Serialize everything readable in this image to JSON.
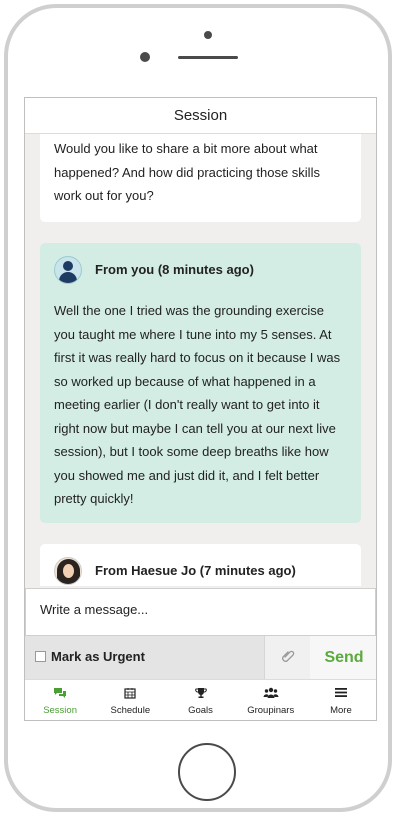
{
  "header": {
    "title": "Session"
  },
  "messages": {
    "previous": {
      "text": "Would you like to share a bit more about what happened? And how did practicing those skills work out for you?"
    },
    "mine": {
      "from": "From you (8 minutes ago)",
      "text": "Well the one I tried was the grounding exercise you taught me where I tune into my 5 senses. At first it was really hard to focus on it because I was so worked up because of what happened in a meeting earlier (I don't really want to get into it right now but maybe I can tell you at our next live session), but I took some deep breaths like how you showed me and just did it, and I felt better pretty quickly!"
    },
    "other": {
      "from": "From Haesue Jo (7 minutes ago)"
    }
  },
  "composer": {
    "placeholder": "Write a message..."
  },
  "actions": {
    "urgent_label": "Mark as Urgent",
    "send_label": "Send",
    "attach_icon": "paperclip-icon"
  },
  "tabs": [
    {
      "label": "Session",
      "icon": "chat-icon",
      "active": true
    },
    {
      "label": "Schedule",
      "icon": "calendar-icon"
    },
    {
      "label": "Goals",
      "icon": "trophy-icon"
    },
    {
      "label": "Groupinars",
      "icon": "group-icon"
    },
    {
      "label": "More",
      "icon": "menu-icon"
    }
  ],
  "colors": {
    "accent": "#5aaa3c",
    "my_bubble": "#d3ede5"
  }
}
